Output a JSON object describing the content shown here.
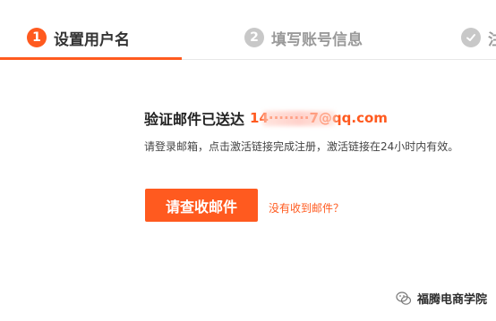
{
  "steps": [
    {
      "number": "1",
      "label": "设置用户名",
      "state": "active"
    },
    {
      "number": "2",
      "label": "填写账号信息",
      "state": "inactive"
    },
    {
      "number": "",
      "label": "注",
      "state": "done"
    }
  ],
  "main": {
    "title": "验证邮件已送达",
    "email": "14········7@qq.com",
    "description": "请登录邮箱，点击激活链接完成注册，激活链接在24小时内有效。",
    "primary_button_label": "请查收邮件",
    "resend_link_label": "没有收到邮件？"
  },
  "watermark": {
    "text": "福腾电商学院",
    "icon": "wechat-icon"
  },
  "colors": {
    "accent": "#ff5a1f",
    "inactive": "#c8c8c8",
    "text": "#222222"
  }
}
